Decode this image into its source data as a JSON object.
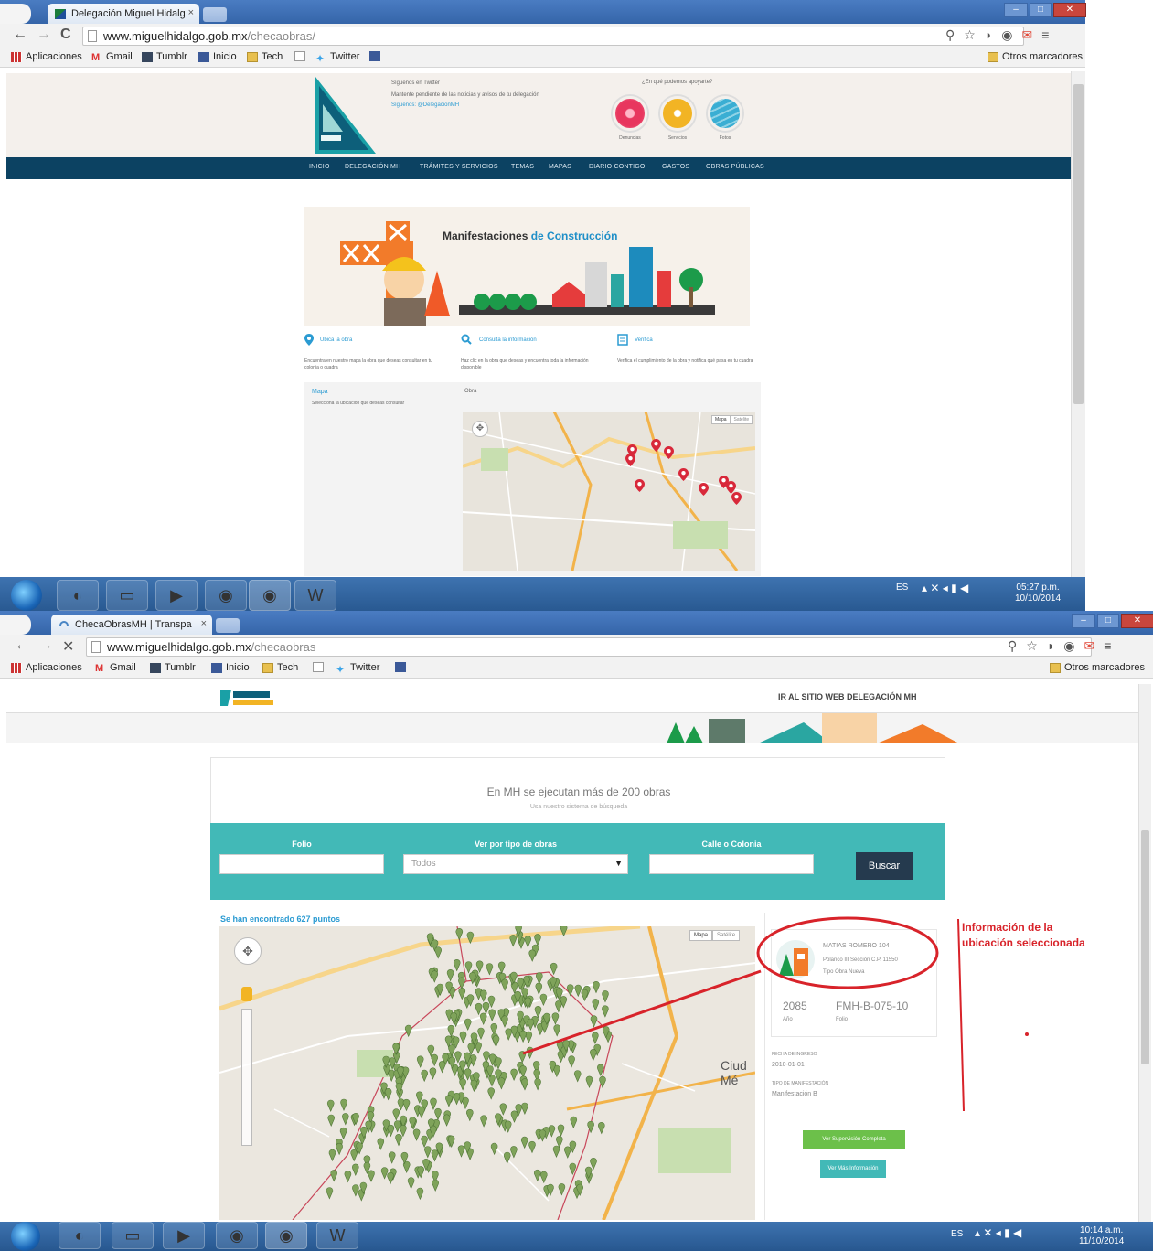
{
  "window1": {
    "tab_title": "Delegación Miguel Hidalg",
    "tab_close": "×",
    "url_host": "www.miguelhidalgo.gob.mx",
    "url_path": "/checaobras/",
    "bookmarks": [
      "Aplicaciones",
      "Gmail",
      "Tumblr",
      "Inicio",
      "Tech",
      "Twitter"
    ],
    "other_bookmarks": "Otros marcadores",
    "header": {
      "twitter_title": "Síguenos en Twitter",
      "twitter_line1": "Mantente pendiente de las noticias y avisos de tu delegación",
      "twitter_line2": "Síguenos: @DelegacionMH",
      "help_title": "¿En qué podemos apoyarte?",
      "circle_labels": [
        "Denuncias",
        "Servicios",
        "Fotos"
      ]
    },
    "nav": [
      "INICIO",
      "DELEGACIÓN MH",
      "TRÁMITES Y SERVICIOS",
      "TEMAS",
      "MAPAS",
      "DIARIO CONTIGO",
      "GASTOS",
      "OBRAS PÚBLICAS"
    ],
    "banner": {
      "title_a": "Manifestaciones",
      "title_b": "de Construcción"
    },
    "steps": [
      {
        "label": "Ubica la obra",
        "desc": "Encuentra en nuestro mapa la obra que deseas consultar en tu colonia o cuadra"
      },
      {
        "label": "Consulta la información",
        "desc": "Haz clic en la obra que deseas y encuentra toda la información disponible"
      },
      {
        "label": "Verifica",
        "desc": "Verifica el cumplimiento de la obra y notifica qué pasa en tu cuadra"
      }
    ],
    "map_panel": {
      "title": "Mapa",
      "desc": "Selecciona la ubicación que deseas consultar",
      "info": "Obra",
      "map_btns": [
        "Mapa",
        "Satélite"
      ]
    },
    "clock": {
      "time": "05:27 p.m.",
      "date": "10/10/2014"
    },
    "tray": "ES"
  },
  "window2": {
    "tab_title": "ChecaObrasMH | Transpa",
    "tab_close": "×",
    "url_host": "www.miguelhidalgo.gob.mx",
    "url_path": "/checaobras",
    "bookmarks": [
      "Aplicaciones",
      "Gmail",
      "Tumblr",
      "Inicio",
      "Tech",
      "Twitter"
    ],
    "other_bookmarks": "Otros marcadores",
    "topbar_link": "IR AL SITIO WEB DELEGACIÓN MH",
    "headline": "En MH se ejecutan más de 200 obras",
    "subline": "Usa nuestro sistema de búsqueda",
    "filters": {
      "folio_label": "Folio",
      "tipo_label": "Ver por tipo de obras",
      "tipo_value": "Todos",
      "calle_label": "Calle o Colonia",
      "search_button": "Buscar"
    },
    "found": "Se han encontrado 627 puntos",
    "map_btns": [
      "Mapa",
      "Satélite"
    ],
    "map_city_label": "Ciud\nMé",
    "details": {
      "address": "MATIAS ROMERO 104",
      "colonia": "Polanco III Sección C.P. 11550",
      "tipo": "Tipo Obra Nueva",
      "number": "2085",
      "number_label": "Año",
      "folio": "FMH-B-075-10",
      "folio_label": "Folio",
      "fecha_label": "FECHA DE INGRESO",
      "fecha": "2010-01-01",
      "tipo_manif_label": "TIPO DE MANIFESTACIÓN",
      "tipo_manif": "Manifestación B",
      "btn_green": "Ver Supervisión Completa",
      "btn_teal": "Ver Más Información"
    },
    "annotation": [
      "Información de la",
      "ubicación seleccionada"
    ],
    "clock": {
      "time": "10:14 a.m.",
      "date": "11/10/2014"
    },
    "tray": "ES"
  },
  "colors": {
    "accent_teal": "#42b9b7",
    "nav_dark": "#0c4262",
    "annotation_red": "#d8232a",
    "button_dark": "#253a4e"
  }
}
